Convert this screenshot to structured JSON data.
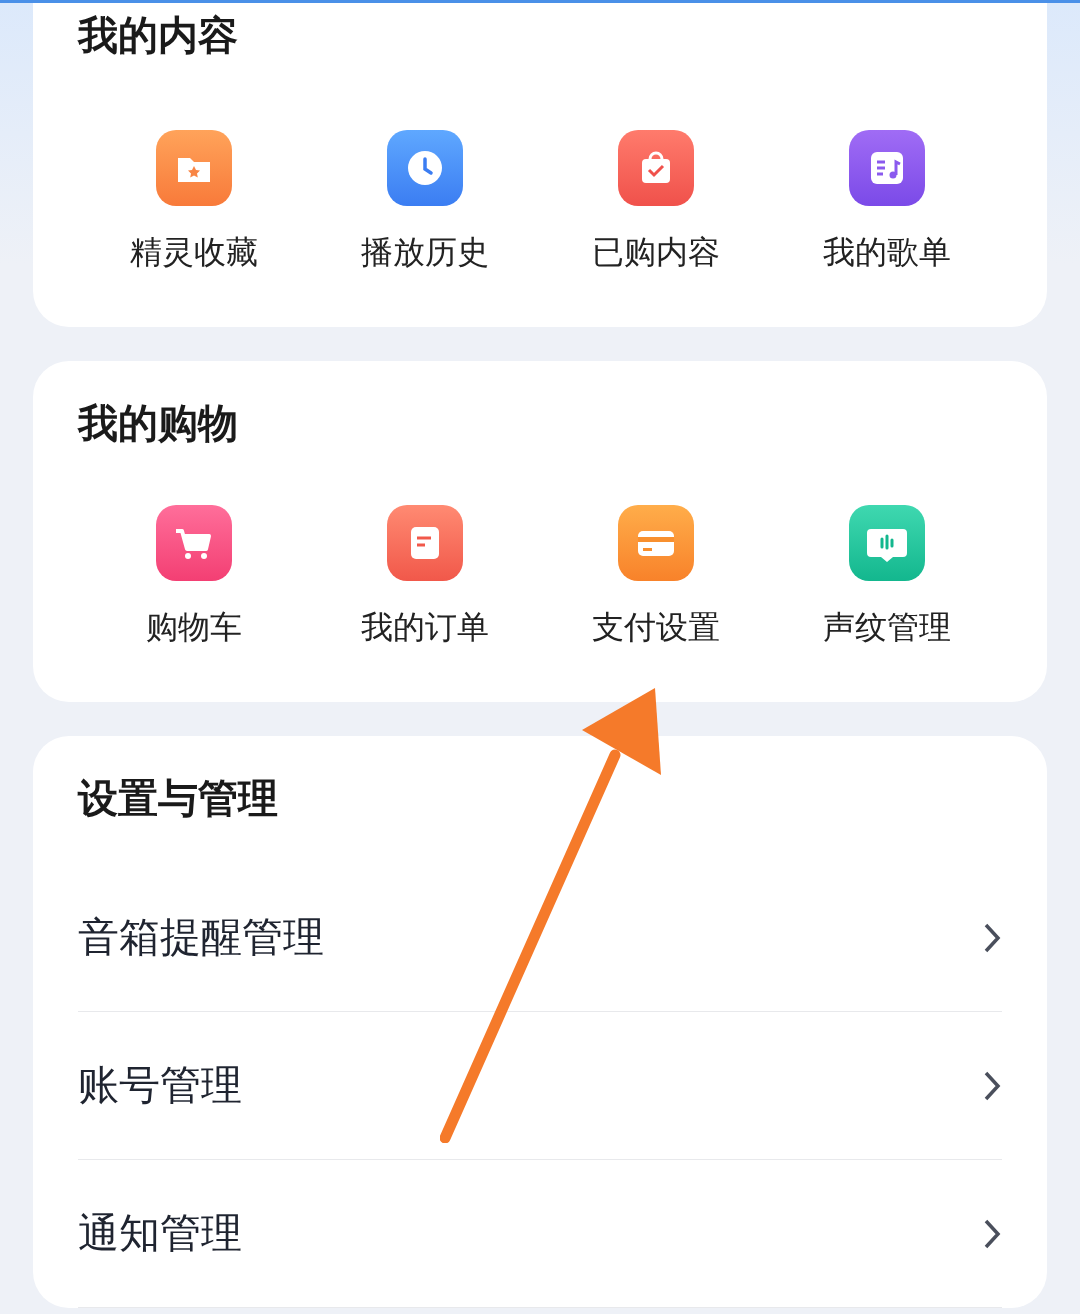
{
  "sections": [
    {
      "kind": "grid",
      "title": "我的内容",
      "items": [
        {
          "label": "精灵收藏"
        },
        {
          "label": "播放历史"
        },
        {
          "label": "已购内容"
        },
        {
          "label": "我的歌单"
        }
      ]
    },
    {
      "kind": "grid",
      "title": "我的购物",
      "items": [
        {
          "label": "购物车"
        },
        {
          "label": "我的订单"
        },
        {
          "label": "支付设置"
        },
        {
          "label": "声纹管理"
        }
      ]
    },
    {
      "kind": "list",
      "title": "设置与管理",
      "items": [
        {
          "label": "音箱提醒管理"
        },
        {
          "label": "账号管理"
        },
        {
          "label": "通知管理"
        }
      ]
    }
  ]
}
